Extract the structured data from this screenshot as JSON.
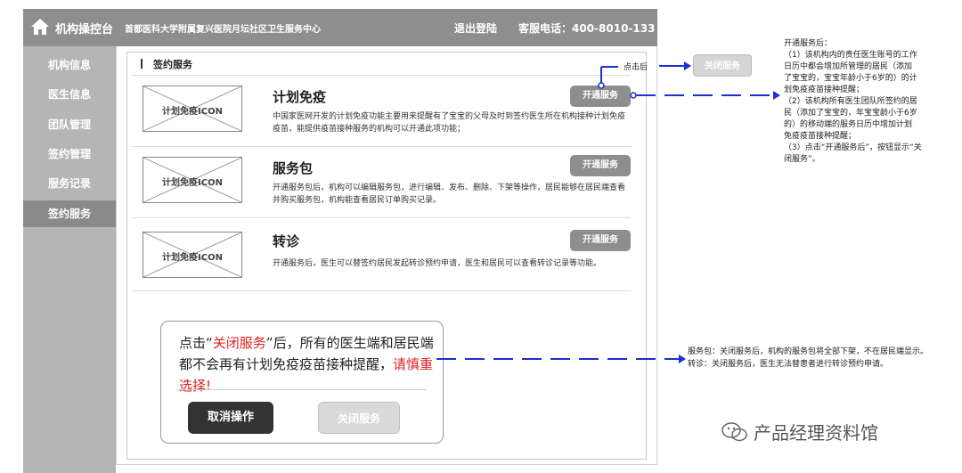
{
  "header": {
    "brand": "机构操控台",
    "hospital": "首都医科大学附属复兴医院月坛社区卫生服务中心",
    "logout": "退出登陆",
    "phone": "客服电话：400-8010-133"
  },
  "sidebar": {
    "items": [
      {
        "label": "机构信息"
      },
      {
        "label": "医生信息"
      },
      {
        "label": "团队管理"
      },
      {
        "label": "签约管理"
      },
      {
        "label": "服务记录"
      },
      {
        "label": "签约服务"
      }
    ]
  },
  "main": {
    "section_title": "签约服务",
    "services": [
      {
        "icon_label": "计划免疫ICON",
        "title": "计划免疫",
        "desc": "中国家医网开发的计划免疫功能主要用来提醒有了宝宝的父母及时到签约医生所在机构接种计划免疫疫苗，能提供疫苗接种服务的机构可以开通此项功能；",
        "button": "开通服务"
      },
      {
        "icon_label": "计划免疫ICON",
        "title": "服务包",
        "desc": "开通服务包后，机构可以编辑服务包，进行编辑、发布、删除、下架等操作，居民能够在居民端查看并购买服务包，机构能查看居民订单购买记录。",
        "button": "开通服务"
      },
      {
        "icon_label": "计划免疫ICON",
        "title": "转诊",
        "desc": "开通服务后，医生可以替签约居民发起转诊预约申请，医生和居民可以查看转诊记录等功能。",
        "button": "开通服务"
      }
    ]
  },
  "annotations": {
    "after_click": "点击后",
    "close_service_demo": "关闭服务",
    "right_note": [
      "开通服务后：",
      "（1）该机构内的责任医生账号的工作",
      "日历中都会增加所管理的居民（添加",
      "了宝宝的，宝宝年龄小于6岁的）的计",
      "划免疫疫苗接种提醒；",
      "（2）该机构所有医生团队所签约的居",
      "民（添加了宝宝的，年宝宝龄小于6岁",
      "的）的移动端的服务日历中增加计划",
      "免疫疫苗接种提醒；",
      "（3）点击“开通服务后”，按钮显示“关",
      "闭服务”。"
    ],
    "bottom_note": [
      "服务包：关闭服务后，机构的服务包将全部下架，不在居民端显示。",
      "转诊：关闭服务后，医生无法替患者进行转诊预约申请。"
    ]
  },
  "dialog": {
    "msg_prefix": "点击“",
    "msg_highlight": "关闭服务",
    "msg_middle": "”后，所有的医生端和居民端都不会再有计划免疫疫苗接种提醒，",
    "msg_warning": "请慎重选择!",
    "cancel": "取消操作",
    "close": "关闭服务"
  },
  "watermark": "产品经理资料馆",
  "colors": {
    "topbar": "#8e8e8e",
    "sidebar": "#b5b5b5",
    "sidebar_active": "#8a8a8a",
    "annotation_line": "#1a2fd6",
    "warning_red": "#e02020"
  }
}
